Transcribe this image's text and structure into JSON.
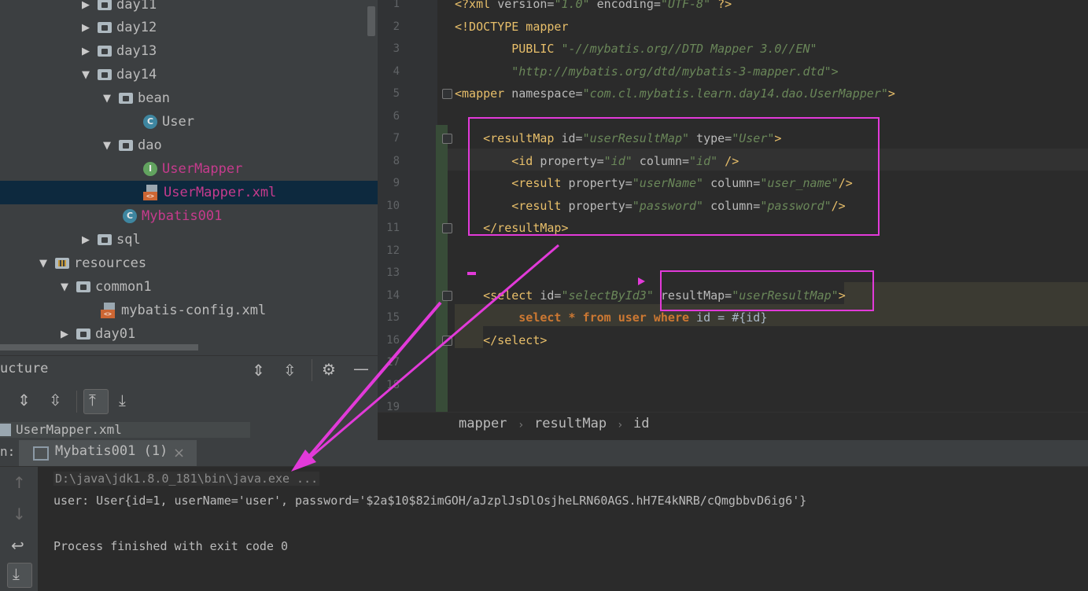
{
  "tree": {
    "items": [
      {
        "label": "day11",
        "type": "folder",
        "expanded": false
      },
      {
        "label": "day12",
        "type": "folder",
        "expanded": false
      },
      {
        "label": "day13",
        "type": "folder",
        "expanded": false
      },
      {
        "label": "day14",
        "type": "folder",
        "expanded": true
      },
      {
        "label": "bean",
        "type": "folder",
        "expanded": true
      },
      {
        "label": "User",
        "type": "class"
      },
      {
        "label": "dao",
        "type": "folder",
        "expanded": true
      },
      {
        "label": "UserMapper",
        "type": "interface"
      },
      {
        "label": "UserMapper.xml",
        "type": "xml",
        "selected": true
      },
      {
        "label": "Mybatis001",
        "type": "class"
      },
      {
        "label": "sql",
        "type": "folder",
        "expanded": false
      },
      {
        "label": "resources",
        "type": "resources",
        "expanded": true
      },
      {
        "label": "common1",
        "type": "folder",
        "expanded": true
      },
      {
        "label": "mybatis-config.xml",
        "type": "xml"
      },
      {
        "label": "day01",
        "type": "folder",
        "expanded": false
      }
    ],
    "class_badge": "C",
    "interface_badge": "I"
  },
  "structure": {
    "title": "ucture",
    "file": "UserMapper.xml"
  },
  "editor": {
    "line_numbers": [
      "1",
      "2",
      "3",
      "4",
      "5",
      "6",
      "7",
      "8",
      "9",
      "10",
      "11",
      "12",
      "13",
      "14",
      "15",
      "16",
      "17",
      "18",
      "19"
    ],
    "lines": {
      "l1": {
        "pi_open": "<?xml ",
        "a1": "version=",
        "v1": "\"1.0\"",
        "a2": " encoding=",
        "v2": "\"UTF-8\"",
        "pi_close": " ?>"
      },
      "l2": {
        "text": "<!DOCTYPE mapper"
      },
      "l3": {
        "kw": "PUBLIC ",
        "v": "\"-//mybatis.org//DTD Mapper 3.0//EN\""
      },
      "l4": {
        "v": "\"http://mybatis.org/dtd/mybatis-3-mapper.dtd\">"
      },
      "l5": {
        "open": "<",
        "tag": "mapper",
        "a": " namespace=",
        "v": "\"com.cl.mybatis.learn.day14.dao.UserMapper\"",
        "close": ">"
      },
      "l7": {
        "open": "<",
        "tag": "resultMap",
        "a1": " id=",
        "v1": "\"userResultMap\"",
        "a2": " type=",
        "v2": "\"User\"",
        "close": ">"
      },
      "l8": {
        "open": "<",
        "tag": "id",
        "a1": " property=",
        "v1": "\"id\"",
        "a2": " column=",
        "v2": "\"id\"",
        "close": " />"
      },
      "l9": {
        "open": "<",
        "tag": "result",
        "a1": " property=",
        "v1": "\"userName\"",
        "a2": " column=",
        "v2": "\"user_name\"",
        "close": "/>"
      },
      "l10": {
        "open": "<",
        "tag": "result",
        "a1": " property=",
        "v1": "\"password\"",
        "a2": " column=",
        "v2": "\"password\"",
        "close": "/>"
      },
      "l11": {
        "text": "</resultMap>"
      },
      "l14": {
        "open": "<",
        "tag": "select",
        "a1": " id=",
        "v1": "\"selectById3\"",
        "a2": " resultMap=",
        "v2": "\"userResultMap\"",
        "close": ">"
      },
      "l15": {
        "k1": "select",
        "s1": " * ",
        "k2": "from",
        "s2": " ",
        "k3": "user",
        "s3": " ",
        "k4": "where",
        "rest": " id = #{id}"
      },
      "l16": {
        "text": "</select>"
      }
    },
    "breadcrumb": [
      "mapper",
      "resultMap",
      "id"
    ],
    "crumb_sep": "›"
  },
  "run": {
    "label": "n:",
    "tab": "Mybatis001 (1)",
    "tab_close": "×",
    "output": {
      "cmd": "D:\\java\\jdk1.8.0_181\\bin\\java.exe ...",
      "result": "user: User{id=1, userName='user', password='$2a$10$82imGOH/aJzplJsDlOsjheLRN60AGS.hH7E4kNRB/cQmgbbvD6ig6'}",
      "exit": "Process finished with exit code 0"
    }
  },
  "colors": {
    "annotation": "#e23ad9",
    "tag": "#e8bf6a",
    "value": "#6a8759",
    "keyword": "#cc7832",
    "modified": "#c63b8d"
  }
}
